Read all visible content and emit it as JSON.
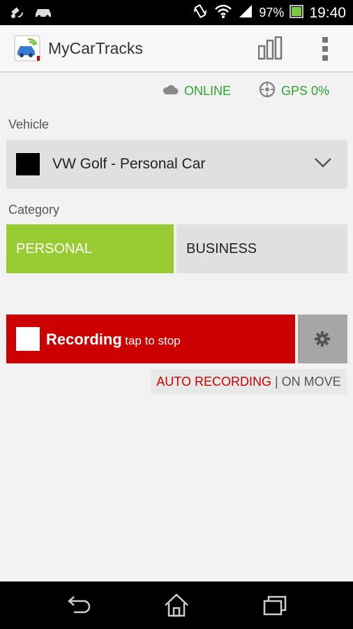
{
  "status_bar": {
    "battery": "97%",
    "time": "19:40",
    "icons": [
      "satellite-icon",
      "car-icon",
      "vibrate-icon",
      "wifi-icon",
      "signal-icon",
      "battery-icon"
    ]
  },
  "app_bar": {
    "title": "MyCarTracks",
    "icons": [
      "app-logo-icon",
      "bar-chart-icon",
      "overflow-menu-icon"
    ]
  },
  "connection": {
    "online_label": "ONLINE",
    "gps_label": "GPS 0%",
    "color": "#2ea32e"
  },
  "vehicle": {
    "label": "Vehicle",
    "selected": "VW Golf - Personal Car",
    "swatch_color": "#000000"
  },
  "category": {
    "label": "Category",
    "options": [
      "PERSONAL",
      "BUSINESS"
    ],
    "selected": "PERSONAL",
    "selected_color": "#99cc33"
  },
  "recording": {
    "title": "Recording",
    "hint": "tap to stop",
    "color": "#cc0000",
    "auto_label": "AUTO RECORDING",
    "separator": "|",
    "auto_mode": "ON MOVE"
  },
  "nav_bar": {
    "icons": [
      "back-icon",
      "home-icon",
      "recent-apps-icon"
    ]
  }
}
